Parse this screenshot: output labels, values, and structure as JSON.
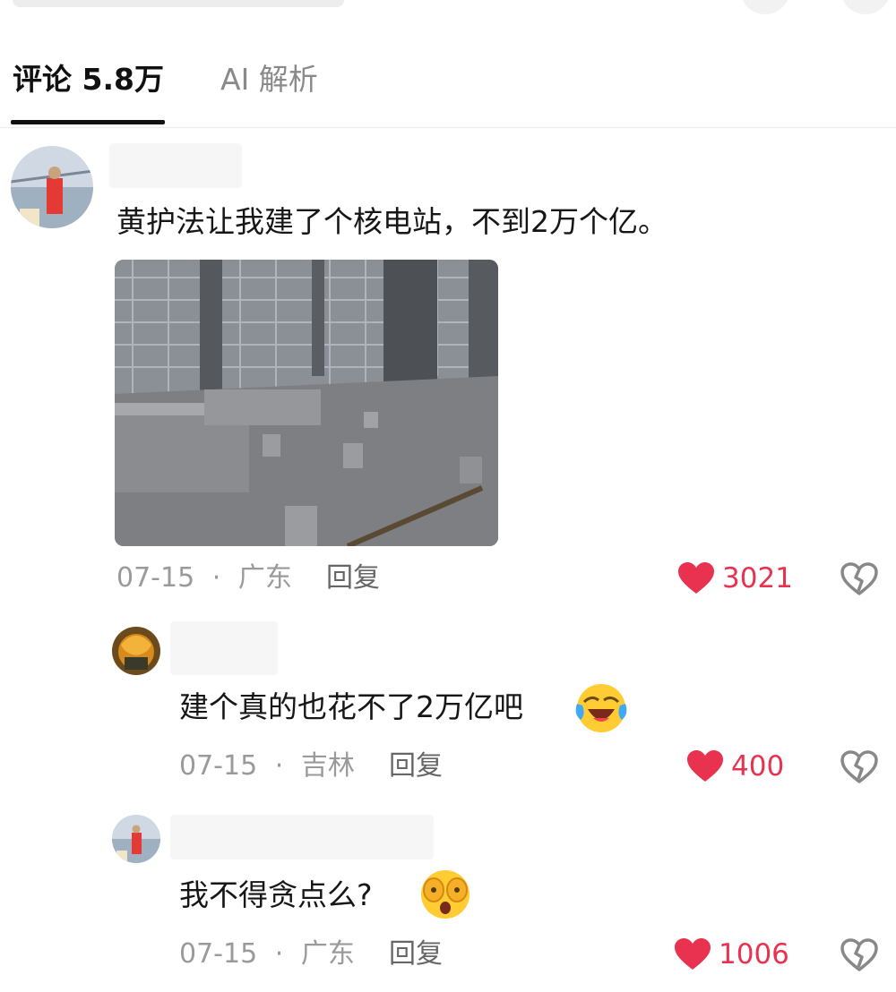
{
  "tabs": {
    "comments_label": "评论 5.8万",
    "ai_label": "AI 解析"
  },
  "comments": [
    {
      "text": "黄护法让我建了个核电站，不到2万个亿。",
      "date": "07-15",
      "location": "广东",
      "reply_label": "回复",
      "likes": "3021"
    },
    {
      "text": "建个真的也花不了2万亿吧",
      "date": "07-15",
      "location": "吉林",
      "reply_label": "回复",
      "likes": "400"
    },
    {
      "text": "我不得贪点么?",
      "date": "07-15",
      "location": "广东",
      "reply_label": "回复",
      "likes": "1006"
    }
  ],
  "meta_separator": "·",
  "icons": {
    "like": "heart-icon",
    "dislike": "broken-heart-icon",
    "emoji1": "laughing-crying-emoji",
    "emoji2": "face-covering-eyes-emoji"
  },
  "colors": {
    "like_accent": "#e8324f",
    "tab_underline": "#111111"
  }
}
